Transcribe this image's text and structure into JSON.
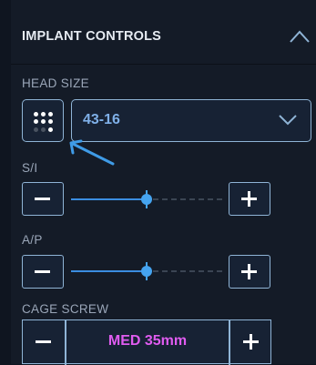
{
  "panel": {
    "title": "IMPLANT CONTROLS",
    "collapse_icon": "chevron-up-icon"
  },
  "head_size": {
    "label": "HEAD SIZE",
    "grid_icon": "dot-grid-icon",
    "value": "43-16",
    "dropdown_icon": "chevron-down-icon"
  },
  "si": {
    "label": "S/I",
    "level": 0.5
  },
  "ap": {
    "label": "A/P",
    "level": 0.5
  },
  "cage_screw": {
    "label": "CAGE SCREW",
    "value": "MED 35mm"
  },
  "colors": {
    "accent": "#45a4f0",
    "border": "#8fb4d6",
    "value_blue": "#7fb0e8",
    "cage_value": "#e05cf0",
    "annotation_arrow": "#3f9be6"
  }
}
